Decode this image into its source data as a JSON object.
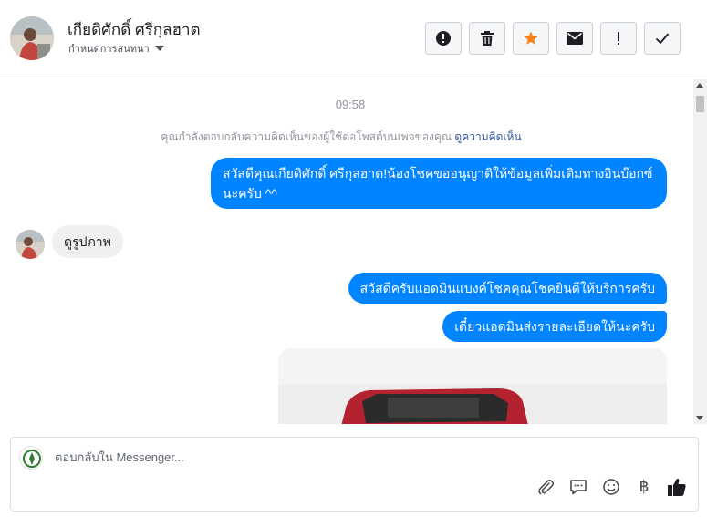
{
  "header": {
    "contact_name": "เกียดิศักดิ์ ศรีกุลฮาต",
    "assign_label": "กำหนดการสนทนา"
  },
  "thread": {
    "timestamp": "09:58",
    "notice_text": "คุณกำลังตอบกลับความคิดเห็นของผู้ใช้ต่อโพสต์บนเพจของคุณ",
    "notice_link": "ดูความคิดเห็น",
    "messages": [
      {
        "direction": "outgoing",
        "text": "สวัสดีคุณเกียดิศักดิ์ ศรีกุลฮาต!น้องโชคขออนุญาติให้ข้อมูลเพิ่มเติมทางอินบ๊อกซ์นะครับ ^^"
      },
      {
        "direction": "incoming",
        "text": "ดูรูปภาพ"
      },
      {
        "direction": "outgoing",
        "text": "สวัสดีครับแอดมินแบงค์โชคคุณโชคยินดีให้บริการครับ"
      },
      {
        "direction": "outgoing",
        "text": "เดี๋ยวแอดมินส่งรายละเอียดให้นะครับ"
      }
    ]
  },
  "composer": {
    "placeholder": "ตอบกลับใน Messenger...",
    "currency_symbol": "฿"
  },
  "colors": {
    "accent": "#0084ff",
    "incoming_bubble": "#f1f0f0",
    "star": "#f5821f"
  },
  "icons": {
    "header_actions": [
      "alert-circle-icon",
      "trash-icon",
      "star-icon",
      "envelope-icon",
      "exclamation-icon",
      "checkmark-icon"
    ],
    "composer_tools": [
      "paperclip-icon",
      "saved-reply-icon",
      "emoji-icon",
      "baht-icon",
      "thumbs-up-icon"
    ]
  }
}
